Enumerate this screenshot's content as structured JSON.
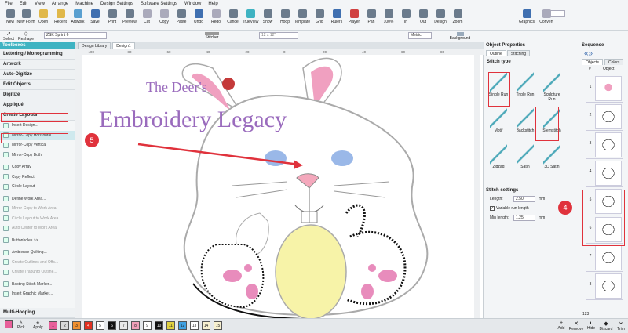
{
  "menu": [
    "File",
    "Edit",
    "View",
    "Arrange",
    "Machine",
    "Design Settings",
    "Software Settings",
    "Window",
    "Help"
  ],
  "ribbon": [
    {
      "label": "New",
      "color": "#6b7b8c"
    },
    {
      "label": "New Form",
      "color": "#6b7b8c"
    },
    {
      "label": "Open",
      "color": "#e0b84a"
    },
    {
      "label": "Recent",
      "color": "#e0b84a"
    },
    {
      "label": "Artwork",
      "color": "#5aa0d0"
    },
    {
      "label": "Save",
      "color": "#3f6fb0"
    },
    {
      "label": "Print",
      "color": "#6b7b8c"
    },
    {
      "label": "Preview",
      "color": "#6b7b8c"
    },
    {
      "label": "Cut",
      "color": "#aab"
    },
    {
      "label": "Copy",
      "color": "#aab"
    },
    {
      "label": "Paste",
      "color": "#6b7b8c"
    },
    {
      "label": "Undo",
      "color": "#3f6fb0"
    },
    {
      "label": "Redo",
      "color": "#aab"
    },
    {
      "label": "Cancel",
      "color": "#6b7b8c"
    },
    {
      "label": "TrueView",
      "color": "#3fb3c2"
    },
    {
      "label": "Show",
      "color": "#6b7b8c"
    },
    {
      "label": "Hoop",
      "color": "#6b7b8c"
    },
    {
      "label": "Template",
      "color": "#6b7b8c"
    },
    {
      "label": "Grid",
      "color": "#6b7b8c"
    },
    {
      "label": "Rulers",
      "color": "#3f6fb0"
    },
    {
      "label": "Player",
      "color": "#d04040"
    },
    {
      "label": "Pan",
      "color": "#6b7b8c"
    },
    {
      "label": "100%",
      "color": "#6b7b8c"
    },
    {
      "label": "In",
      "color": "#6b7b8c"
    },
    {
      "label": "Out",
      "color": "#6b7b8c"
    },
    {
      "label": "Design",
      "color": "#6b7b8c"
    },
    {
      "label": "Zoom",
      "color": "#6b7b8c"
    },
    {
      "label": "Graphics",
      "color": "#3f6fb0"
    },
    {
      "label": "Convert",
      "color": "#aab"
    }
  ],
  "zoom_value": "184",
  "toolbar2": {
    "select": "Select",
    "reshape": "Reshape",
    "machine": "ZSK Sprint 6",
    "stitcher": "Stitcher",
    "hoop_size": "12 x 12\"",
    "units": "Metric",
    "background": "Background"
  },
  "toolbox": {
    "title": "Toolboxes",
    "categories_top": [
      "Lettering / Monogramming",
      "Artwork",
      "Auto-Digitize",
      "Edit Objects",
      "Digitize",
      "Appliqué"
    ],
    "create_layouts": "Create Layouts",
    "tools": [
      {
        "label": "Insert Design...",
        "disabled": false,
        "gap": false
      },
      {
        "label": "Mirror-Copy Horizontal",
        "disabled": false,
        "gap": false,
        "selected": true
      },
      {
        "label": "Mirror-Copy Vertical",
        "disabled": false,
        "gap": false
      },
      {
        "label": "Mirror-Copy Both",
        "disabled": false,
        "gap": false
      },
      {
        "label": "Copy Array",
        "disabled": false,
        "gap": true
      },
      {
        "label": "Copy Reflect",
        "disabled": false,
        "gap": false
      },
      {
        "label": "Circle Layout",
        "disabled": false,
        "gap": false
      },
      {
        "label": "Define Work Area...",
        "disabled": false,
        "gap": true
      },
      {
        "label": "Mirror-Copy to Work Area",
        "disabled": true,
        "gap": false
      },
      {
        "label": "Circle Layout to Work Area",
        "disabled": true,
        "gap": false
      },
      {
        "label": "Auto Center to Work Area",
        "disabled": true,
        "gap": false
      },
      {
        "label": "Buttonholes >>",
        "disabled": false,
        "gap": true
      },
      {
        "label": "Ambience Quilting...",
        "disabled": false,
        "gap": true
      },
      {
        "label": "Create Outlines and Offs...",
        "disabled": true,
        "gap": false
      },
      {
        "label": "Create Trapunto Outline...",
        "disabled": true,
        "gap": false
      },
      {
        "label": "Basting Stitch Marker...",
        "disabled": false,
        "gap": true
      },
      {
        "label": "Insert Graphic Marker...",
        "disabled": false,
        "gap": false
      }
    ],
    "multi_hooping": "Multi-Hooping"
  },
  "tabs": [
    "Design Library",
    "Design1"
  ],
  "ruler_marks": [
    "-100",
    "-80",
    "-60",
    "-40",
    "-20",
    "0",
    "20",
    "40",
    "60",
    "80"
  ],
  "logo": {
    "line1": "The Deer's",
    "line2": "Embroidery Legacy"
  },
  "callout_5": "5",
  "callout_4": "4",
  "object_properties": {
    "title": "Object Properties",
    "tabs": [
      "Outline",
      "Stitching"
    ],
    "stitch_type_label": "Stitch type",
    "stitch_types": [
      "Single Run",
      "Triple Run",
      "Sculpture Run",
      "Motif",
      "Backstitch",
      "Stemstitch",
      "Zigzag",
      "Satin",
      "3D Satin"
    ],
    "settings_label": "Stitch settings",
    "length_label": "Length:",
    "length_value": "2.50",
    "length_unit": "mm",
    "variable_label": "Variable run length",
    "min_length_label": "Min length:",
    "min_length_value": "1.25",
    "min_length_unit": "mm"
  },
  "sequence": {
    "title": "Sequence",
    "tabs": [
      "Objects",
      "Colors"
    ],
    "col_num": "#",
    "col_obj": "Object",
    "rows": [
      "1",
      "2",
      "3",
      "4",
      "5",
      "6",
      "7",
      "8"
    ],
    "footer": "123"
  },
  "statusbar": {
    "pick": "Pick",
    "apply": "Apply",
    "swatches": [
      {
        "n": "1",
        "c": "#e8609a"
      },
      {
        "n": "2",
        "c": "#d8d8d8"
      },
      {
        "n": "3",
        "c": "#f09030"
      },
      {
        "n": "4",
        "c": "#e03020"
      },
      {
        "n": "5",
        "c": "#ffffff"
      },
      {
        "n": "6",
        "c": "#101010"
      },
      {
        "n": "7",
        "c": "#e8e8e8"
      },
      {
        "n": "8",
        "c": "#f0a0b8"
      },
      {
        "n": "9",
        "c": "#ffffff"
      },
      {
        "n": "10",
        "c": "#101010"
      },
      {
        "n": "11",
        "c": "#e0d040"
      },
      {
        "n": "12",
        "c": "#40a0e0"
      },
      {
        "n": "13",
        "c": "#ffffff"
      },
      {
        "n": "14",
        "c": "#f7f0d0"
      },
      {
        "n": "15",
        "c": "#f7f0d0"
      }
    ],
    "add": "Add",
    "remove": "Remove",
    "hide": "Hide",
    "discard": "Discard",
    "trim": "Trim"
  },
  "colors": {
    "accent": "#3fb3c2",
    "callout": "#e0323c",
    "logo_purple": "#9a6bbd"
  }
}
